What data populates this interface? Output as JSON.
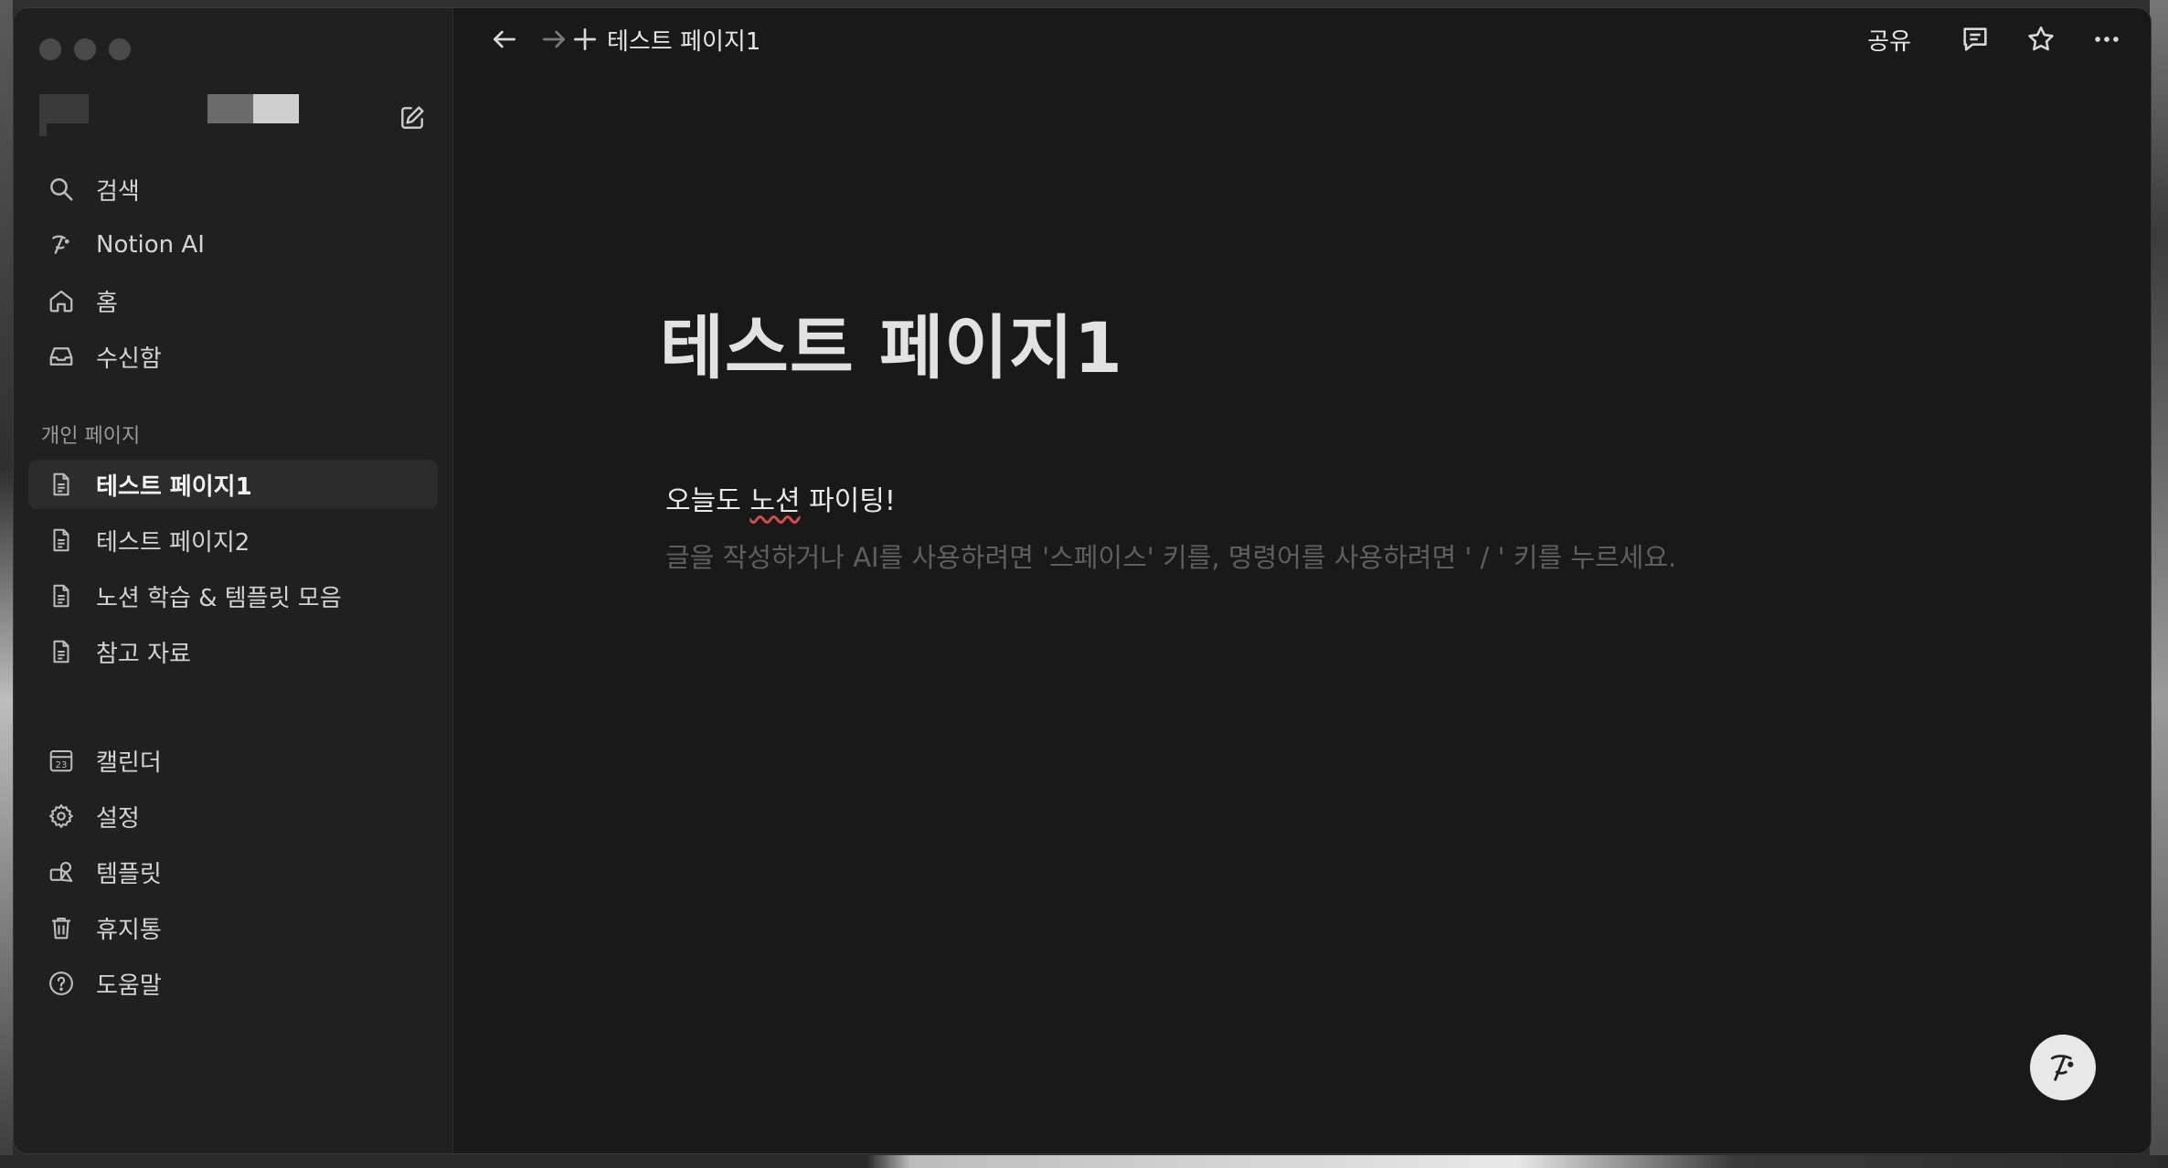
{
  "sidebar": {
    "top_nav": [
      {
        "label": "검색",
        "icon": "search-icon"
      },
      {
        "label": "Notion AI",
        "icon": "notion-ai-icon"
      },
      {
        "label": "홈",
        "icon": "home-icon"
      },
      {
        "label": "수신함",
        "icon": "inbox-icon"
      }
    ],
    "section_label": "개인 페이지",
    "pages": [
      {
        "label": "테스트 페이지1",
        "icon": "page-icon",
        "active": true
      },
      {
        "label": "테스트 페이지2",
        "icon": "page-icon",
        "active": false
      },
      {
        "label": "노션 학습 & 템플릿 모음",
        "icon": "page-icon",
        "active": false
      },
      {
        "label": "참고 자료",
        "icon": "page-icon",
        "active": false
      }
    ],
    "bottom_nav": [
      {
        "label": "캘린더",
        "icon": "calendar-icon",
        "badge": "23"
      },
      {
        "label": "설정",
        "icon": "gear-icon"
      },
      {
        "label": "템플릿",
        "icon": "template-icon"
      },
      {
        "label": "휴지통",
        "icon": "trash-icon"
      },
      {
        "label": "도움말",
        "icon": "help-icon"
      }
    ]
  },
  "topbar": {
    "breadcrumb": "테스트 페이지1",
    "share_label": "공유"
  },
  "page": {
    "title": "테스트 페이지1",
    "body_prefix": "오늘도 ",
    "body_marked": "노션",
    "body_suffix": " 파이팅!",
    "placeholder": "글을 작성하거나 AI를 사용하려면 '스페이스' 키를, 명령어를 사용하려면 ' / ' 키를 누르세요."
  },
  "colors": {
    "window_bg": "#191919",
    "sidebar_bg": "#202020",
    "active_item_bg": "#2c2c2c"
  }
}
